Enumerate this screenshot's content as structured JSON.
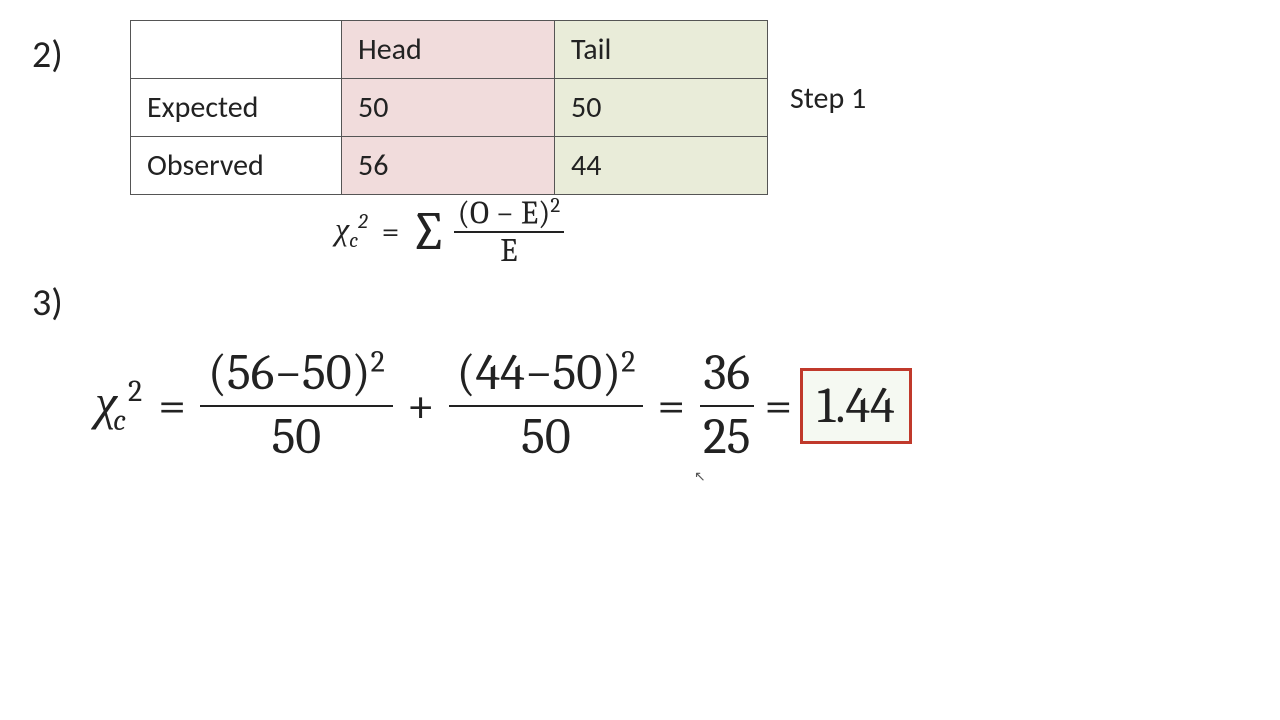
{
  "q2": "2)",
  "q3": "3)",
  "step": "Step 1",
  "table": {
    "header_head": "Head",
    "header_tail": "Tail",
    "row_expected": "Expected",
    "row_observed": "Observed",
    "expected_head": "50",
    "expected_tail": "50",
    "observed_head": "56",
    "observed_tail": "44"
  },
  "formula": {
    "chi": "χ",
    "sub": "c",
    "sup": "2",
    "eq": "=",
    "sigma": "∑",
    "numerator": "(O − E)",
    "num_sup": "2",
    "denominator": "E"
  },
  "calc": {
    "chi": "χ",
    "sub": "c",
    "sup": "2",
    "eq": "=",
    "plus": "+",
    "term1_num_base": "(56−50)",
    "term1_num_sup": "2",
    "term1_den": "50",
    "term2_num_base": "(44−50)",
    "term2_num_sup": "2",
    "term2_den": "50",
    "frac3_num": "36",
    "frac3_den": "25",
    "result": "1.44"
  }
}
